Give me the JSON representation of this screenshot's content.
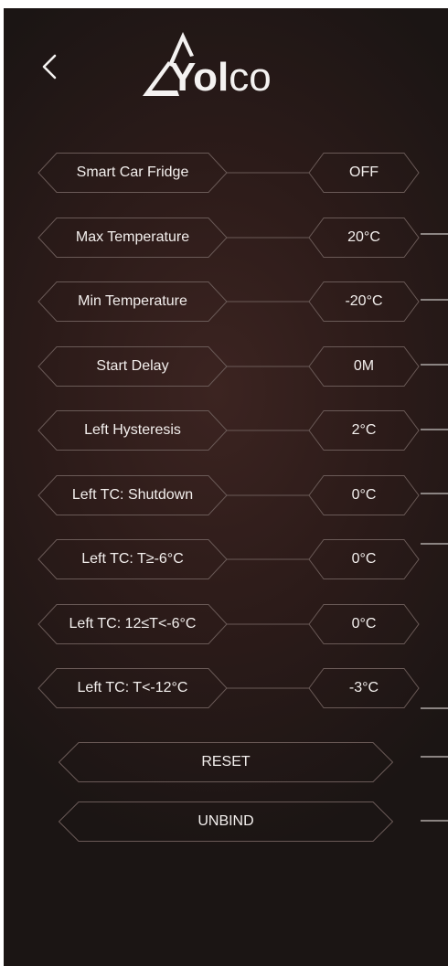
{
  "header": {
    "back_icon": "chevron-left-icon",
    "logo": {
      "text_bold": "Yol",
      "text_light": "co",
      "icon": "triangle-peak-logo-icon"
    }
  },
  "settings": [
    {
      "label": "Smart Car Fridge",
      "value": "OFF"
    },
    {
      "label": "Max Temperature",
      "value": "20°C"
    },
    {
      "label": "Min Temperature",
      "value": "-20°C"
    },
    {
      "label": "Start Delay",
      "value": "0M"
    },
    {
      "label": "Left Hysteresis",
      "value": "2°C"
    },
    {
      "label": "Left TC: Shutdown",
      "value": "0°C"
    },
    {
      "label": "Left TC: T≥-6°C",
      "value": "0°C"
    },
    {
      "label": "Left TC: 12≤T<-6°C",
      "value": "0°C"
    },
    {
      "label": "Left TC: T<-12°C",
      "value": "-3°C"
    }
  ],
  "actions": {
    "reset_label": "RESET",
    "unbind_label": "UNBIND"
  },
  "colors": {
    "background": "#2c1b19",
    "frame_stroke": "#6a5a57",
    "text": "#f3efed",
    "scroll_tick": "#8b8482"
  }
}
